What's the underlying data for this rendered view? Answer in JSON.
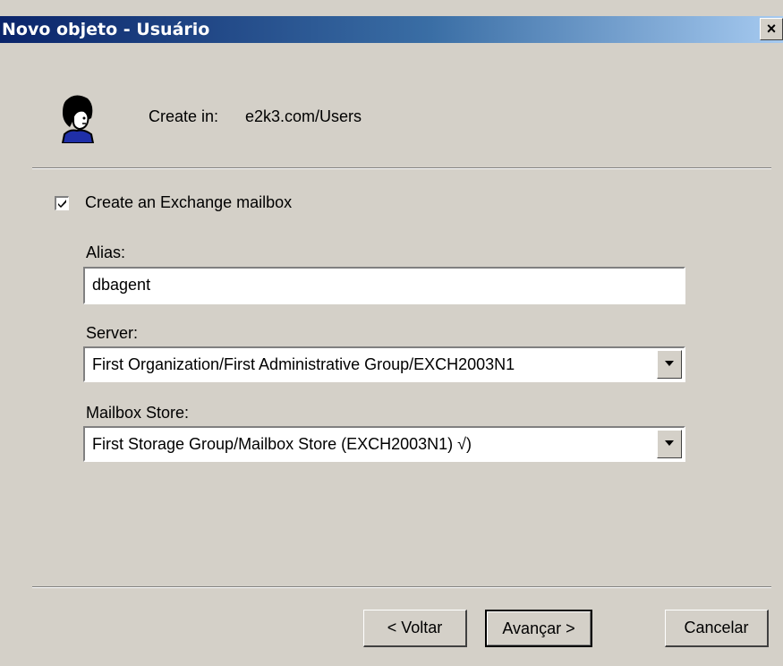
{
  "window": {
    "title": "Novo objeto - Usuário",
    "close_glyph": "×"
  },
  "header": {
    "icon": "user-icon",
    "create_in_label": "Create in:",
    "create_in_value": "e2k3.com/Users"
  },
  "mailbox": {
    "checkbox_label": "Create an Exchange mailbox",
    "checked": true,
    "alias_label": "Alias:",
    "alias_value": "dbagent",
    "server_label": "Server:",
    "server_value": "First Organization/First Administrative Group/EXCH2003N1",
    "store_label": "Mailbox Store:",
    "store_value": "First Storage Group/Mailbox Store (EXCH2003N1) √)"
  },
  "buttons": {
    "back": "< Voltar",
    "next": "Avançar >",
    "cancel": "Cancelar"
  },
  "colors": {
    "face": "#d4d0c8",
    "title_start": "#0a246a",
    "title_end": "#a6caf0"
  }
}
